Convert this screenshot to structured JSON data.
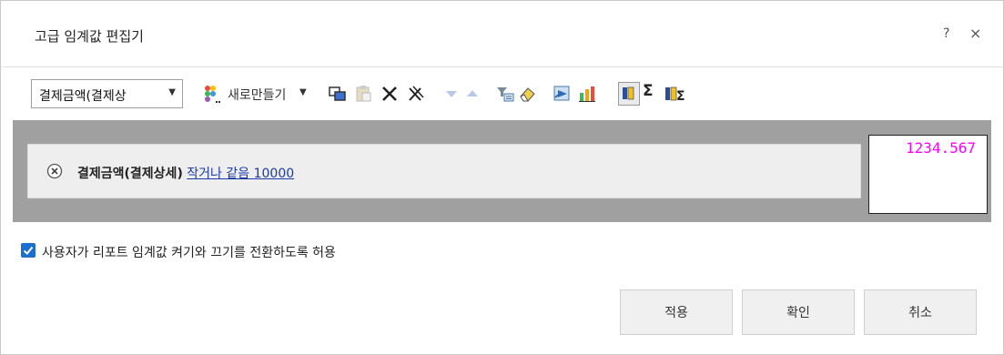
{
  "dialog": {
    "title": "고급 임계값 편집기",
    "help_label": "?",
    "close_label": "×"
  },
  "toolbar": {
    "measure_select": {
      "value": "결제금액(결제상",
      "arrow": "▼"
    },
    "new_label": "새로만들기",
    "new_arrow": "▼",
    "sigma": "Σ"
  },
  "condition": {
    "field": "결제금액(결제상세)",
    "operator_text": "작거나 같음 10000"
  },
  "preview": {
    "value": "1234.567",
    "color": "#ff00ff"
  },
  "options": {
    "toggle_label": "사용자가 리포트 임계값 켜기와 끄기를 전환하도록 허용",
    "toggle_checked": true
  },
  "buttons": {
    "apply": "적용",
    "ok": "확인",
    "cancel": "취소"
  },
  "colors": {
    "canvas": "#a0a0a0",
    "accent": "#1a6fd0",
    "link": "#1a3aa8"
  }
}
